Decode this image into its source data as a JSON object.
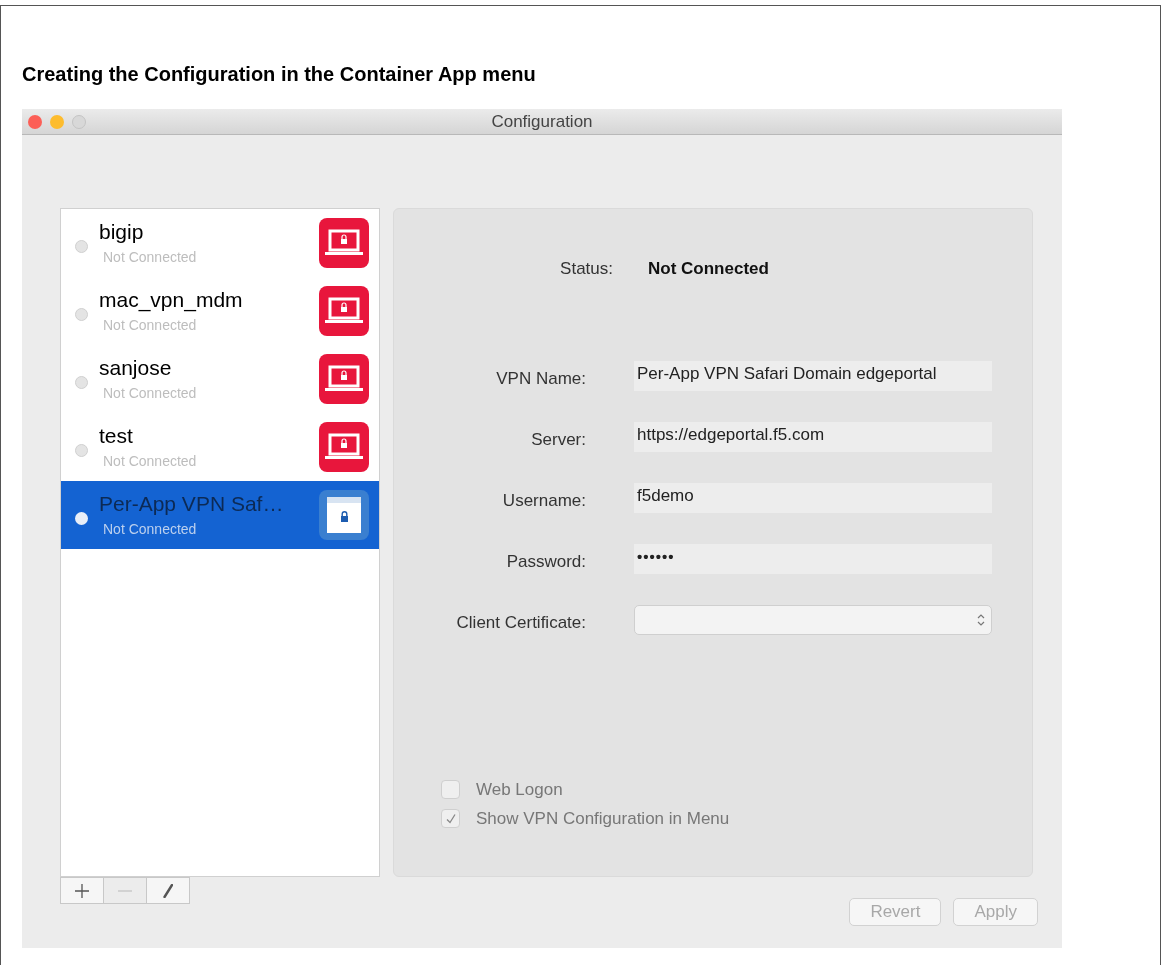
{
  "heading": "Creating the Configuration in the Container App menu",
  "window": {
    "title": "Configuration"
  },
  "connections": [
    {
      "name": "bigip",
      "status": "Not Connected",
      "kind": "laptop",
      "selected": false
    },
    {
      "name": "mac_vpn_mdm",
      "status": "Not Connected",
      "kind": "laptop",
      "selected": false
    },
    {
      "name": "sanjose",
      "status": "Not Connected",
      "kind": "laptop",
      "selected": false
    },
    {
      "name": "test",
      "status": "Not Connected",
      "kind": "laptop",
      "selected": false
    },
    {
      "name": "Per-App VPN Saf…",
      "status": "Not Connected",
      "kind": "browser",
      "selected": true
    }
  ],
  "list_toolbar": [
    {
      "kind": "add",
      "disabled": false
    },
    {
      "kind": "remove",
      "disabled": true
    },
    {
      "kind": "edit",
      "disabled": false
    }
  ],
  "status": {
    "label": "Status:",
    "value": "Not Connected"
  },
  "fields": [
    {
      "label": "VPN Name:",
      "value": "Per-App VPN Safari Domain edgeportal",
      "kind": "text"
    },
    {
      "label": "Server:",
      "value": "https://edgeportal.f5.com",
      "kind": "text"
    },
    {
      "label": "Username:",
      "value": "f5demo",
      "kind": "text"
    },
    {
      "label": "Password:",
      "value": "••••••",
      "kind": "password"
    },
    {
      "label": "Client Certificate:",
      "kind": "select"
    }
  ],
  "options": [
    {
      "label": "Web Logon",
      "checked": false
    },
    {
      "label": "Show VPN Configuration in Menu",
      "checked": true
    }
  ],
  "buttons": [
    {
      "label": "Revert",
      "disabled": true
    },
    {
      "label": "Apply",
      "disabled": true
    }
  ]
}
